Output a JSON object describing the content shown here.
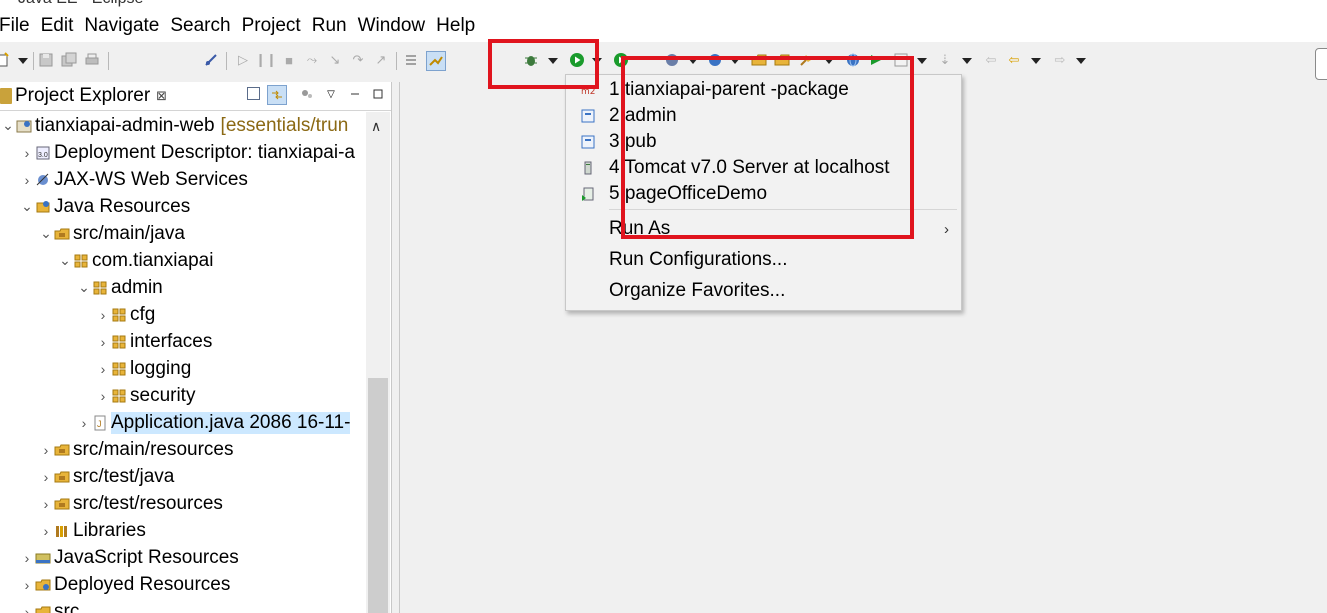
{
  "window": {
    "title": "Java EE - Eclipse"
  },
  "menu": [
    "File",
    "Edit",
    "Navigate",
    "Search",
    "Project",
    "Run",
    "Window",
    "Help"
  ],
  "explorer": {
    "tab_label": "Project Explorer",
    "close_glyph": "⊠",
    "tree": [
      {
        "label": "tianxiapai-admin-web",
        "annotation": "[essentials/trun",
        "depth": 0,
        "twisty": "expanded",
        "icon": "web-project-icon"
      },
      {
        "label": "Deployment Descriptor: tianxiapai-a",
        "depth": 1,
        "twisty": "collapsed",
        "icon": "deployment-descriptor-icon"
      },
      {
        "label": "JAX-WS Web Services",
        "depth": 1,
        "twisty": "collapsed",
        "icon": "web-services-icon"
      },
      {
        "label": "Java Resources",
        "depth": 1,
        "twisty": "expanded",
        "icon": "java-resources-icon"
      },
      {
        "label": "src/main/java",
        "depth": 2,
        "twisty": "expanded",
        "icon": "source-folder-icon"
      },
      {
        "label": "com.tianxiapai",
        "depth": 3,
        "twisty": "expanded",
        "icon": "package-icon"
      },
      {
        "label": "admin",
        "depth": 4,
        "twisty": "expanded",
        "icon": "package-icon"
      },
      {
        "label": "cfg",
        "depth": 5,
        "twisty": "collapsed",
        "icon": "package-icon"
      },
      {
        "label": "interfaces",
        "depth": 5,
        "twisty": "collapsed",
        "icon": "package-icon"
      },
      {
        "label": "logging",
        "depth": 5,
        "twisty": "collapsed",
        "icon": "package-icon"
      },
      {
        "label": "security",
        "depth": 5,
        "twisty": "collapsed",
        "icon": "package-icon"
      },
      {
        "label": "Application.java 2086  16-11-",
        "depth": 4,
        "twisty": "collapsed",
        "icon": "java-file-icon",
        "selected": true
      },
      {
        "label": "src/main/resources",
        "depth": 2,
        "twisty": "collapsed",
        "icon": "source-folder-icon"
      },
      {
        "label": "src/test/java",
        "depth": 2,
        "twisty": "collapsed",
        "icon": "source-folder-icon"
      },
      {
        "label": "src/test/resources",
        "depth": 2,
        "twisty": "collapsed",
        "icon": "source-folder-icon"
      },
      {
        "label": "Libraries",
        "depth": 2,
        "twisty": "collapsed",
        "icon": "libraries-icon"
      },
      {
        "label": "JavaScript Resources",
        "depth": 1,
        "twisty": "collapsed",
        "icon": "javascript-resources-icon"
      },
      {
        "label": "Deployed Resources",
        "depth": 1,
        "twisty": "collapsed",
        "icon": "deployed-resources-icon"
      },
      {
        "label": "src",
        "depth": 1,
        "twisty": "collapsed",
        "icon": "folder-icon"
      }
    ]
  },
  "run_menu": {
    "items": [
      {
        "label": "1 tianxiapai-parent -package",
        "icon": "maven-launch-icon"
      },
      {
        "label": "2 admin",
        "icon": "java-app-launch-icon"
      },
      {
        "label": "3 pub",
        "icon": "java-app-launch-icon"
      },
      {
        "label": "4 Tomcat v7.0 Server at localhost",
        "icon": "server-launch-icon"
      },
      {
        "label": "5 pageOfficeDemo",
        "icon": "java-app-launch-icon"
      }
    ],
    "run_as": "Run As",
    "run_configurations": "Run Configurations...",
    "organize_favorites": "Organize Favorites..."
  },
  "colors": {
    "highlight_red": "#e0141e",
    "selection": "#cce8ff",
    "run_green": "#1a9b2c"
  }
}
